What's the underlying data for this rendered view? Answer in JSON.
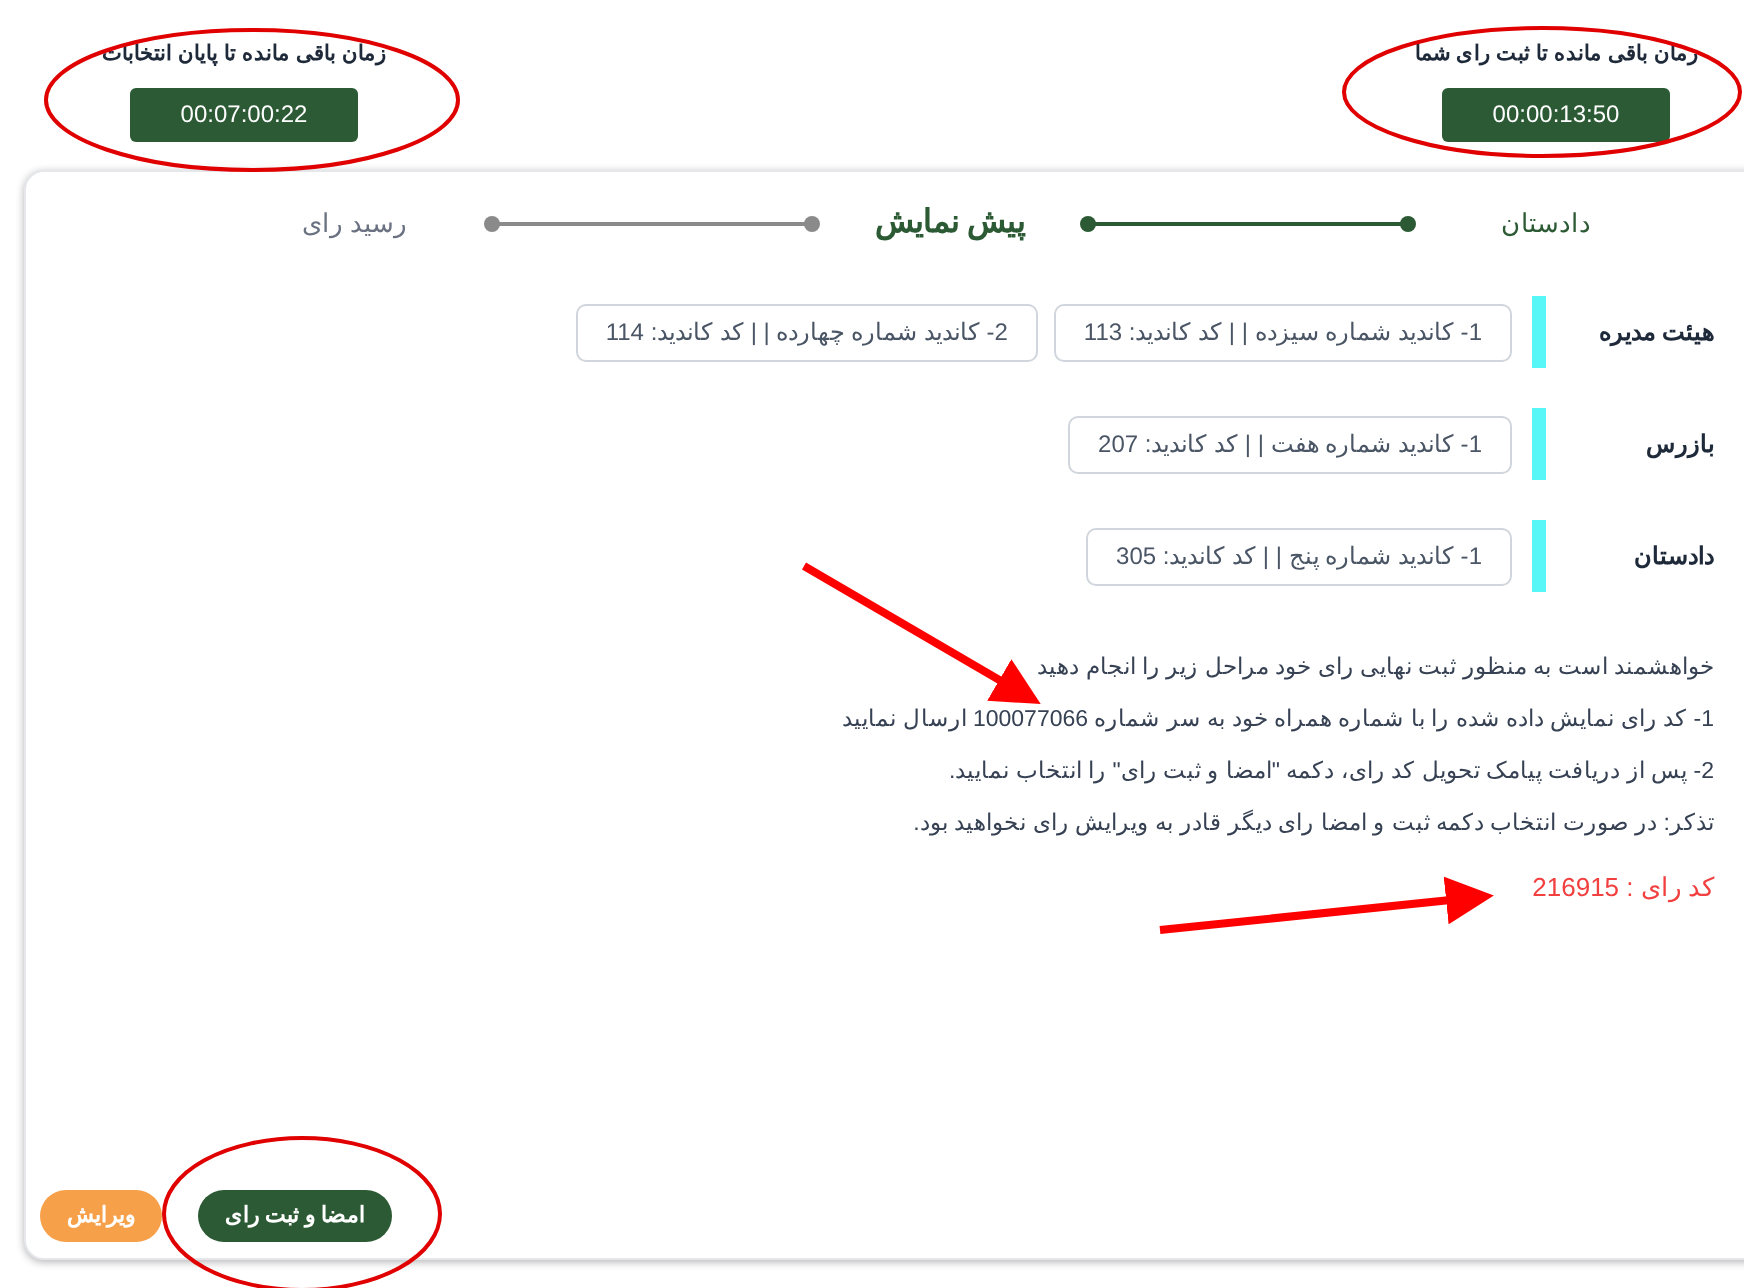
{
  "timers": [
    {
      "title": "زمان باقی مانده تا ثبت رای شما",
      "value": "00:00:13:50"
    },
    {
      "title": "زمان باقی مانده تا پایان انتخابات",
      "value": "00:07:00:22"
    }
  ],
  "steps": [
    {
      "label": "دادستان",
      "done": true,
      "selected": false
    },
    {
      "label": "پیش نمایش",
      "done": false,
      "selected": true
    },
    {
      "label": "رسید رای",
      "done": false,
      "selected": false
    }
  ],
  "sections": [
    {
      "title": "هیئت مدیره",
      "candidates": [
        "1- کاندید شماره سیزده | | کد کاندید: 113",
        "2- کاندید شماره چهارده | | کد کاندید: 114"
      ]
    },
    {
      "title": "بازرس",
      "candidates": [
        "1- کاندید شماره هفت | | کد کاندید: 207"
      ]
    },
    {
      "title": "دادستان",
      "candidates": [
        "1- کاندید شماره پنج | | کد کاندید: 305"
      ]
    }
  ],
  "instructions": [
    "خواهشمند است به منظور ثبت نهایی رای خود مراحل زیر را انجام دهید",
    "1- کد رای نمایش داده شده را با شماره همراه خود به سر شماره 100077066 ارسال نمایید",
    "2- پس از دریافت پیامک تحویل کد رای، دکمه \"امضا و ثبت رای\" را انتخاب نمایید.",
    "تذکر: در صورت انتخاب دکمه ثبت و امضا رای دیگر قادر به ویرایش رای نخواهید بود."
  ],
  "vote_code": "کد رای : 216915",
  "buttons": [
    {
      "label": "امضا و ثبت رای",
      "kind": "primary"
    },
    {
      "label": "ویرایش",
      "kind": "secondary"
    }
  ]
}
